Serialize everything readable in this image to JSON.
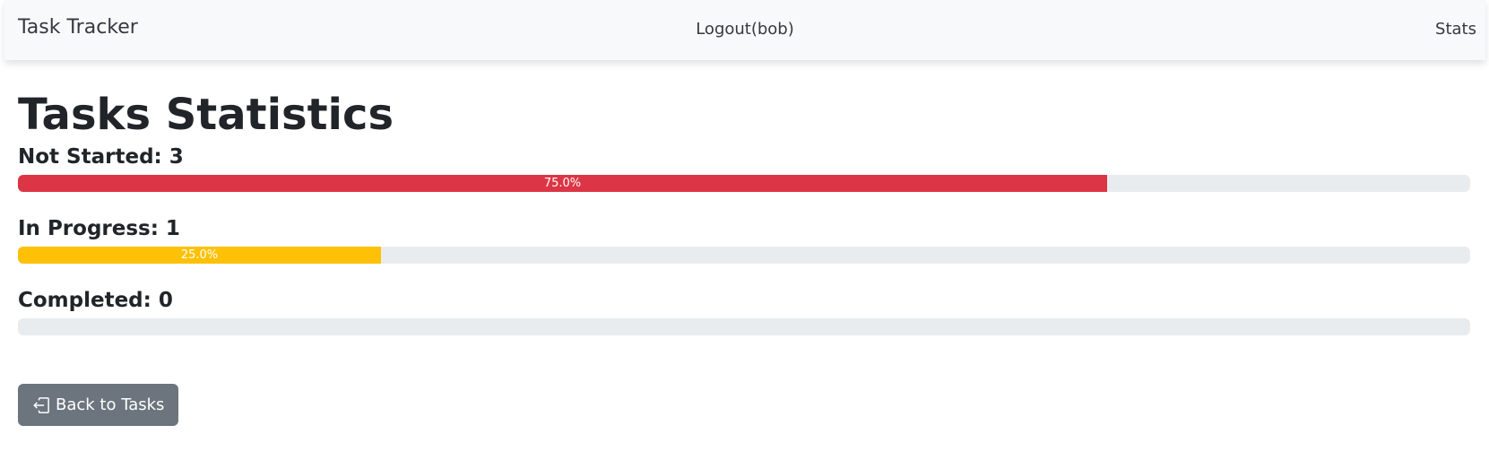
{
  "navbar": {
    "brand": "Task Tracker",
    "logout_label": "Logout(bob)",
    "stats_label": "Stats"
  },
  "main": {
    "title": "Tasks Statistics",
    "stats": [
      {
        "label": "Not Started: 3",
        "percent_label": "75.0%",
        "percent": 75.0,
        "color": "#dc3545"
      },
      {
        "label": "In Progress: 1",
        "percent_label": "25.0%",
        "percent": 25.0,
        "color": "#ffc107"
      },
      {
        "label": "Completed: 0",
        "percent_label": "",
        "percent": 0.0,
        "color": "#198754"
      }
    ],
    "back_button": {
      "label": "Back to Tasks",
      "icon": "box-arrow-in-left-icon"
    }
  },
  "colors": {
    "navbar_bg": "#f8f9fa",
    "track": "#e9ecef",
    "secondary_button": "#6c757d"
  }
}
